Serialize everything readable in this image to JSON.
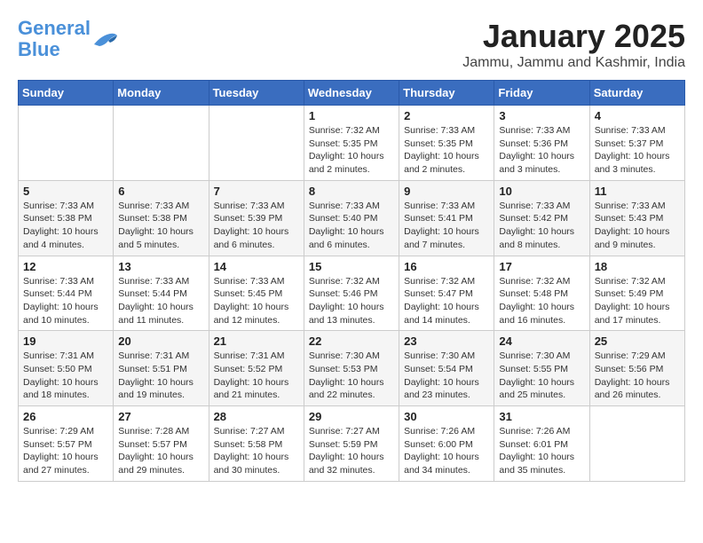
{
  "header": {
    "logo_line1": "General",
    "logo_line2": "Blue",
    "title": "January 2025",
    "subtitle": "Jammu, Jammu and Kashmir, India"
  },
  "days_of_week": [
    "Sunday",
    "Monday",
    "Tuesday",
    "Wednesday",
    "Thursday",
    "Friday",
    "Saturday"
  ],
  "weeks": [
    [
      {
        "day": "",
        "info": ""
      },
      {
        "day": "",
        "info": ""
      },
      {
        "day": "",
        "info": ""
      },
      {
        "day": "1",
        "info": "Sunrise: 7:32 AM\nSunset: 5:35 PM\nDaylight: 10 hours and 2 minutes."
      },
      {
        "day": "2",
        "info": "Sunrise: 7:33 AM\nSunset: 5:35 PM\nDaylight: 10 hours and 2 minutes."
      },
      {
        "day": "3",
        "info": "Sunrise: 7:33 AM\nSunset: 5:36 PM\nDaylight: 10 hours and 3 minutes."
      },
      {
        "day": "4",
        "info": "Sunrise: 7:33 AM\nSunset: 5:37 PM\nDaylight: 10 hours and 3 minutes."
      }
    ],
    [
      {
        "day": "5",
        "info": "Sunrise: 7:33 AM\nSunset: 5:38 PM\nDaylight: 10 hours and 4 minutes."
      },
      {
        "day": "6",
        "info": "Sunrise: 7:33 AM\nSunset: 5:38 PM\nDaylight: 10 hours and 5 minutes."
      },
      {
        "day": "7",
        "info": "Sunrise: 7:33 AM\nSunset: 5:39 PM\nDaylight: 10 hours and 6 minutes."
      },
      {
        "day": "8",
        "info": "Sunrise: 7:33 AM\nSunset: 5:40 PM\nDaylight: 10 hours and 6 minutes."
      },
      {
        "day": "9",
        "info": "Sunrise: 7:33 AM\nSunset: 5:41 PM\nDaylight: 10 hours and 7 minutes."
      },
      {
        "day": "10",
        "info": "Sunrise: 7:33 AM\nSunset: 5:42 PM\nDaylight: 10 hours and 8 minutes."
      },
      {
        "day": "11",
        "info": "Sunrise: 7:33 AM\nSunset: 5:43 PM\nDaylight: 10 hours and 9 minutes."
      }
    ],
    [
      {
        "day": "12",
        "info": "Sunrise: 7:33 AM\nSunset: 5:44 PM\nDaylight: 10 hours and 10 minutes."
      },
      {
        "day": "13",
        "info": "Sunrise: 7:33 AM\nSunset: 5:44 PM\nDaylight: 10 hours and 11 minutes."
      },
      {
        "day": "14",
        "info": "Sunrise: 7:33 AM\nSunset: 5:45 PM\nDaylight: 10 hours and 12 minutes."
      },
      {
        "day": "15",
        "info": "Sunrise: 7:32 AM\nSunset: 5:46 PM\nDaylight: 10 hours and 13 minutes."
      },
      {
        "day": "16",
        "info": "Sunrise: 7:32 AM\nSunset: 5:47 PM\nDaylight: 10 hours and 14 minutes."
      },
      {
        "day": "17",
        "info": "Sunrise: 7:32 AM\nSunset: 5:48 PM\nDaylight: 10 hours and 16 minutes."
      },
      {
        "day": "18",
        "info": "Sunrise: 7:32 AM\nSunset: 5:49 PM\nDaylight: 10 hours and 17 minutes."
      }
    ],
    [
      {
        "day": "19",
        "info": "Sunrise: 7:31 AM\nSunset: 5:50 PM\nDaylight: 10 hours and 18 minutes."
      },
      {
        "day": "20",
        "info": "Sunrise: 7:31 AM\nSunset: 5:51 PM\nDaylight: 10 hours and 19 minutes."
      },
      {
        "day": "21",
        "info": "Sunrise: 7:31 AM\nSunset: 5:52 PM\nDaylight: 10 hours and 21 minutes."
      },
      {
        "day": "22",
        "info": "Sunrise: 7:30 AM\nSunset: 5:53 PM\nDaylight: 10 hours and 22 minutes."
      },
      {
        "day": "23",
        "info": "Sunrise: 7:30 AM\nSunset: 5:54 PM\nDaylight: 10 hours and 23 minutes."
      },
      {
        "day": "24",
        "info": "Sunrise: 7:30 AM\nSunset: 5:55 PM\nDaylight: 10 hours and 25 minutes."
      },
      {
        "day": "25",
        "info": "Sunrise: 7:29 AM\nSunset: 5:56 PM\nDaylight: 10 hours and 26 minutes."
      }
    ],
    [
      {
        "day": "26",
        "info": "Sunrise: 7:29 AM\nSunset: 5:57 PM\nDaylight: 10 hours and 27 minutes."
      },
      {
        "day": "27",
        "info": "Sunrise: 7:28 AM\nSunset: 5:57 PM\nDaylight: 10 hours and 29 minutes."
      },
      {
        "day": "28",
        "info": "Sunrise: 7:27 AM\nSunset: 5:58 PM\nDaylight: 10 hours and 30 minutes."
      },
      {
        "day": "29",
        "info": "Sunrise: 7:27 AM\nSunset: 5:59 PM\nDaylight: 10 hours and 32 minutes."
      },
      {
        "day": "30",
        "info": "Sunrise: 7:26 AM\nSunset: 6:00 PM\nDaylight: 10 hours and 34 minutes."
      },
      {
        "day": "31",
        "info": "Sunrise: 7:26 AM\nSunset: 6:01 PM\nDaylight: 10 hours and 35 minutes."
      },
      {
        "day": "",
        "info": ""
      }
    ]
  ]
}
